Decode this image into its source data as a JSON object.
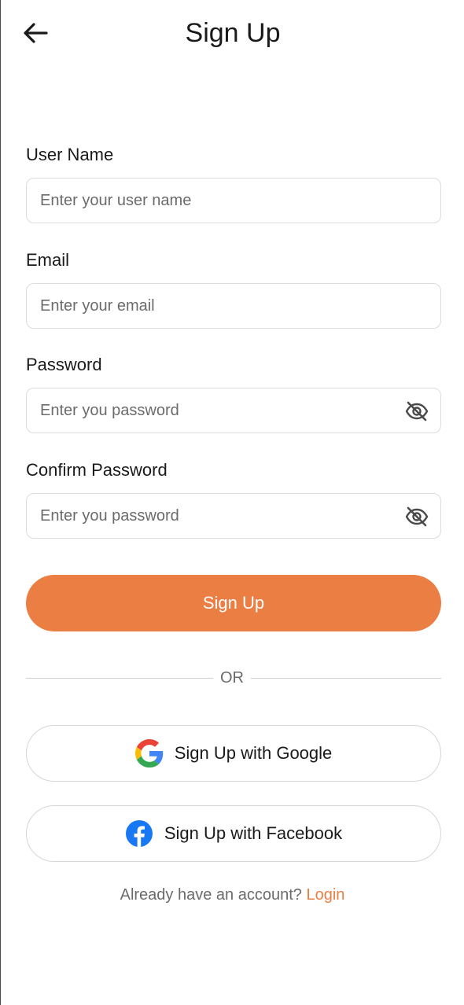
{
  "header": {
    "title": "Sign Up",
    "back_icon": "arrow-left-icon"
  },
  "form": {
    "username": {
      "label": "User Name",
      "placeholder": "Enter your user name",
      "value": ""
    },
    "email": {
      "label": "Email",
      "placeholder": "Enter your email",
      "value": ""
    },
    "password": {
      "label": "Password",
      "placeholder": "Enter you password",
      "value": "",
      "toggle_icon": "eye-off-icon"
    },
    "confirm_password": {
      "label": "Confirm Password",
      "placeholder": "Enter you password",
      "value": "",
      "toggle_icon": "eye-off-icon"
    },
    "submit_label": "Sign Up"
  },
  "divider": {
    "text": "OR"
  },
  "social": {
    "google_label": "Sign Up with Google",
    "google_icon": "google-icon",
    "facebook_label": "Sign Up with Facebook",
    "facebook_icon": "facebook-icon"
  },
  "footer": {
    "prompt": "Already have an account?",
    "link": "Login"
  },
  "colors": {
    "accent": "#eb7e42",
    "facebook": "#1877f2",
    "border": "#dcdcdc",
    "placeholder": "#6b6b6b"
  }
}
